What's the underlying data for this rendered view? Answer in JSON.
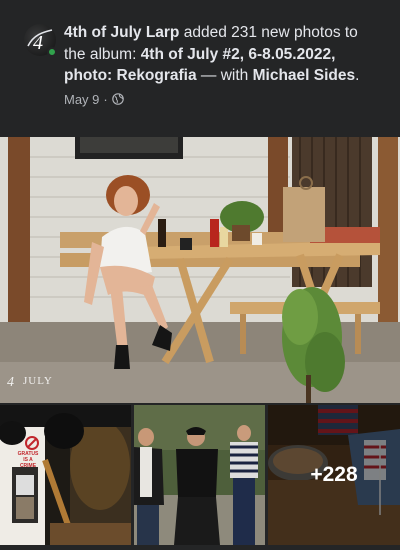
{
  "post": {
    "page_name": "4th of July Larp",
    "action_text": " added 231 new photos to the album: ",
    "album_title": "4th of July #2, 6-8.05.2022, photo: Rekografia",
    "with_text": " — with ",
    "tagged_person": "Michael Sides",
    "period": ".",
    "date": "May 9",
    "separator": "·",
    "privacy_icon": "globe-icon",
    "avatar_letter": "4"
  },
  "photos": {
    "watermark": "JULY",
    "sign_line1": "GRATUS",
    "sign_line2": "IS A",
    "sign_line3": "CRIME",
    "more_count": "+228"
  },
  "colors": {
    "background": "#242526",
    "text_primary": "#e4e6eb",
    "text_secondary": "#b0b3b8",
    "online_status": "#31a24c"
  }
}
